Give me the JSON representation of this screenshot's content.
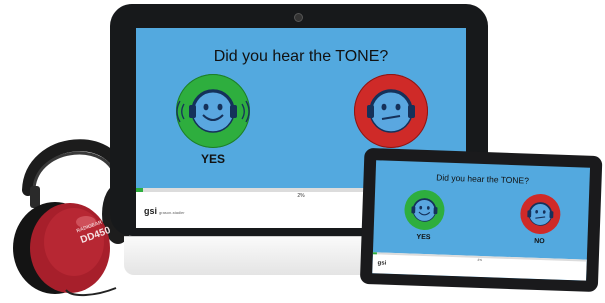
{
  "headphones": {
    "brand": "RADIOEAR",
    "model": "DD450"
  },
  "monitor": {
    "question": "Did you hear the TONE?",
    "yes_label": "YES",
    "no_label": "NO",
    "progress_text": "2%",
    "progress_fraction": 0.02,
    "logo_text": "gsi",
    "logo_subtext": "grason-stadler"
  },
  "tablet": {
    "question": "Did you hear the TONE?",
    "yes_label": "YES",
    "no_label": "NO",
    "progress_text": "2%",
    "progress_fraction": 0.02,
    "logo_text": "gsi"
  },
  "icons": {
    "yes_face": "smiley-headphones-icon",
    "no_face": "neutral-face-headphones-icon"
  },
  "colors": {
    "screen_bg": "#53a9df",
    "yes_green": "#2eae3e",
    "no_red": "#cf2a28",
    "bezel": "#17191b",
    "headphone_red": "#a71f2b"
  }
}
